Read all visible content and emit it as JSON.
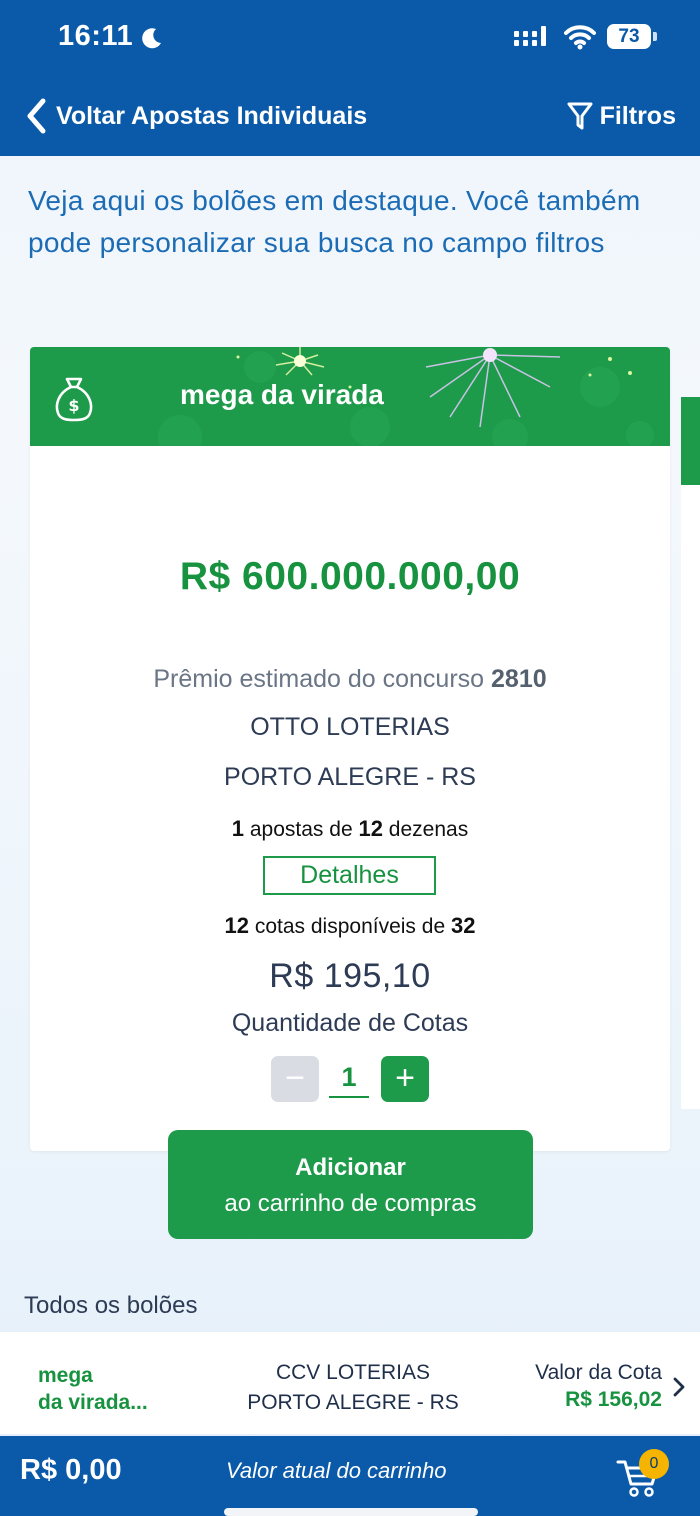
{
  "status_bar": {
    "time": "16:11",
    "battery": "73"
  },
  "header": {
    "back_label": "Voltar Apostas Individuais",
    "filter_label": "Filtros"
  },
  "intro_text": "Veja aqui os bolões em destaque. Você também pode personalizar sua busca no campo filtros",
  "featured": {
    "game_name": "mega da virada",
    "prize": "R$ 600.000.000,00",
    "estimate_text": "Prêmio estimado do concurso",
    "contest_number": "2810",
    "lottery_name": "OTTO LOTERIAS",
    "lottery_city": "PORTO ALEGRE - RS",
    "bets_count": "1",
    "bets_mid": "apostas de",
    "dozens_count": "12",
    "dozens_label": "dezenas",
    "details_label": "Detalhes",
    "quotas_available": "12",
    "quotas_mid": "cotas disponíveis de",
    "quotas_total": "32",
    "quota_price": "R$ 195,10",
    "quantity_label": "Quantidade de Cotas",
    "quantity_value": "1",
    "minus_symbol": "−",
    "plus_symbol": "+"
  },
  "add_to_cart": {
    "line1": "Adicionar",
    "line2": "ao carrinho de compras"
  },
  "all_pools": {
    "title": "Todos os bolões",
    "items": [
      {
        "game_line1": "mega",
        "game_line2": "da virada...",
        "lottery_name": "CCV LOTERIAS",
        "lottery_city": "PORTO ALEGRE - RS",
        "price_label": "Valor da Cota",
        "price": "R$ 156,02"
      }
    ]
  },
  "cart": {
    "total": "R$ 0,00",
    "label": "Valor atual do carrinho",
    "badge": "0"
  },
  "colors": {
    "brand_blue": "#0b5aa9",
    "brand_green": "#1d9a4a",
    "text_green": "#17923f",
    "badge_yellow": "#f5b400"
  }
}
